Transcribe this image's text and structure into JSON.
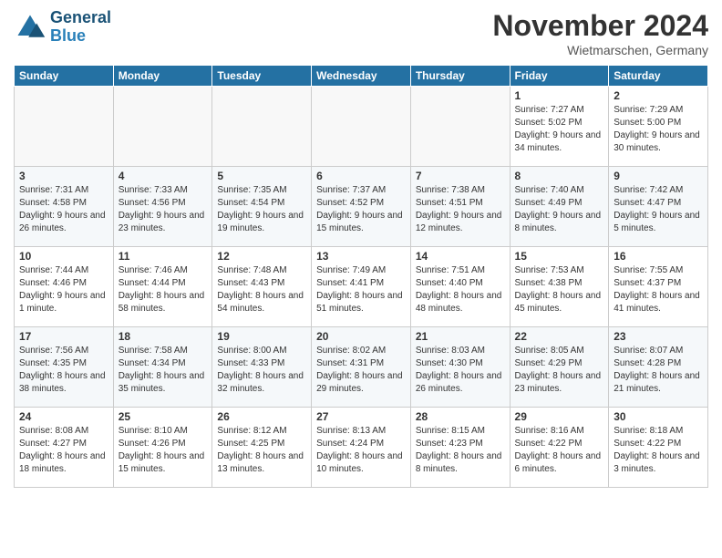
{
  "logo": {
    "line1": "General",
    "line2": "Blue"
  },
  "title": "November 2024",
  "location": "Wietmarschen, Germany",
  "weekdays": [
    "Sunday",
    "Monday",
    "Tuesday",
    "Wednesday",
    "Thursday",
    "Friday",
    "Saturday"
  ],
  "weeks": [
    [
      {
        "day": "",
        "info": ""
      },
      {
        "day": "",
        "info": ""
      },
      {
        "day": "",
        "info": ""
      },
      {
        "day": "",
        "info": ""
      },
      {
        "day": "",
        "info": ""
      },
      {
        "day": "1",
        "info": "Sunrise: 7:27 AM\nSunset: 5:02 PM\nDaylight: 9 hours and 34 minutes."
      },
      {
        "day": "2",
        "info": "Sunrise: 7:29 AM\nSunset: 5:00 PM\nDaylight: 9 hours and 30 minutes."
      }
    ],
    [
      {
        "day": "3",
        "info": "Sunrise: 7:31 AM\nSunset: 4:58 PM\nDaylight: 9 hours and 26 minutes."
      },
      {
        "day": "4",
        "info": "Sunrise: 7:33 AM\nSunset: 4:56 PM\nDaylight: 9 hours and 23 minutes."
      },
      {
        "day": "5",
        "info": "Sunrise: 7:35 AM\nSunset: 4:54 PM\nDaylight: 9 hours and 19 minutes."
      },
      {
        "day": "6",
        "info": "Sunrise: 7:37 AM\nSunset: 4:52 PM\nDaylight: 9 hours and 15 minutes."
      },
      {
        "day": "7",
        "info": "Sunrise: 7:38 AM\nSunset: 4:51 PM\nDaylight: 9 hours and 12 minutes."
      },
      {
        "day": "8",
        "info": "Sunrise: 7:40 AM\nSunset: 4:49 PM\nDaylight: 9 hours and 8 minutes."
      },
      {
        "day": "9",
        "info": "Sunrise: 7:42 AM\nSunset: 4:47 PM\nDaylight: 9 hours and 5 minutes."
      }
    ],
    [
      {
        "day": "10",
        "info": "Sunrise: 7:44 AM\nSunset: 4:46 PM\nDaylight: 9 hours and 1 minute."
      },
      {
        "day": "11",
        "info": "Sunrise: 7:46 AM\nSunset: 4:44 PM\nDaylight: 8 hours and 58 minutes."
      },
      {
        "day": "12",
        "info": "Sunrise: 7:48 AM\nSunset: 4:43 PM\nDaylight: 8 hours and 54 minutes."
      },
      {
        "day": "13",
        "info": "Sunrise: 7:49 AM\nSunset: 4:41 PM\nDaylight: 8 hours and 51 minutes."
      },
      {
        "day": "14",
        "info": "Sunrise: 7:51 AM\nSunset: 4:40 PM\nDaylight: 8 hours and 48 minutes."
      },
      {
        "day": "15",
        "info": "Sunrise: 7:53 AM\nSunset: 4:38 PM\nDaylight: 8 hours and 45 minutes."
      },
      {
        "day": "16",
        "info": "Sunrise: 7:55 AM\nSunset: 4:37 PM\nDaylight: 8 hours and 41 minutes."
      }
    ],
    [
      {
        "day": "17",
        "info": "Sunrise: 7:56 AM\nSunset: 4:35 PM\nDaylight: 8 hours and 38 minutes."
      },
      {
        "day": "18",
        "info": "Sunrise: 7:58 AM\nSunset: 4:34 PM\nDaylight: 8 hours and 35 minutes."
      },
      {
        "day": "19",
        "info": "Sunrise: 8:00 AM\nSunset: 4:33 PM\nDaylight: 8 hours and 32 minutes."
      },
      {
        "day": "20",
        "info": "Sunrise: 8:02 AM\nSunset: 4:31 PM\nDaylight: 8 hours and 29 minutes."
      },
      {
        "day": "21",
        "info": "Sunrise: 8:03 AM\nSunset: 4:30 PM\nDaylight: 8 hours and 26 minutes."
      },
      {
        "day": "22",
        "info": "Sunrise: 8:05 AM\nSunset: 4:29 PM\nDaylight: 8 hours and 23 minutes."
      },
      {
        "day": "23",
        "info": "Sunrise: 8:07 AM\nSunset: 4:28 PM\nDaylight: 8 hours and 21 minutes."
      }
    ],
    [
      {
        "day": "24",
        "info": "Sunrise: 8:08 AM\nSunset: 4:27 PM\nDaylight: 8 hours and 18 minutes."
      },
      {
        "day": "25",
        "info": "Sunrise: 8:10 AM\nSunset: 4:26 PM\nDaylight: 8 hours and 15 minutes."
      },
      {
        "day": "26",
        "info": "Sunrise: 8:12 AM\nSunset: 4:25 PM\nDaylight: 8 hours and 13 minutes."
      },
      {
        "day": "27",
        "info": "Sunrise: 8:13 AM\nSunset: 4:24 PM\nDaylight: 8 hours and 10 minutes."
      },
      {
        "day": "28",
        "info": "Sunrise: 8:15 AM\nSunset: 4:23 PM\nDaylight: 8 hours and 8 minutes."
      },
      {
        "day": "29",
        "info": "Sunrise: 8:16 AM\nSunset: 4:22 PM\nDaylight: 8 hours and 6 minutes."
      },
      {
        "day": "30",
        "info": "Sunrise: 8:18 AM\nSunset: 4:22 PM\nDaylight: 8 hours and 3 minutes."
      }
    ]
  ]
}
